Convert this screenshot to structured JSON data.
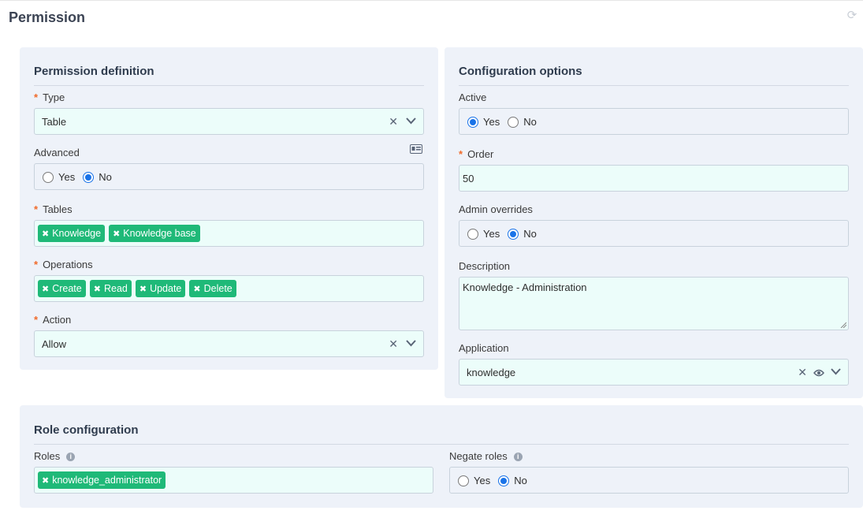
{
  "page": {
    "title": "Permission",
    "refresh_icon": "refresh-icon"
  },
  "permission_definition": {
    "title": "Permission definition",
    "type": {
      "label": "Type",
      "value": "Table"
    },
    "advanced": {
      "label": "Advanced",
      "yes": "Yes",
      "no": "No",
      "selected": "No"
    },
    "tables": {
      "label": "Tables",
      "tags": [
        "Knowledge",
        "Knowledge base"
      ]
    },
    "operations": {
      "label": "Operations",
      "tags": [
        "Create",
        "Read",
        "Update",
        "Delete"
      ]
    },
    "action": {
      "label": "Action",
      "value": "Allow"
    }
  },
  "configuration": {
    "title": "Configuration options",
    "active": {
      "label": "Active",
      "yes": "Yes",
      "no": "No",
      "selected": "Yes"
    },
    "order": {
      "label": "Order",
      "value": "50"
    },
    "admin_overrides": {
      "label": "Admin overrides",
      "yes": "Yes",
      "no": "No",
      "selected": "No"
    },
    "description": {
      "label": "Description",
      "value": "Knowledge - Administration"
    },
    "application": {
      "label": "Application",
      "value": "knowledge"
    }
  },
  "role_configuration": {
    "title": "Role configuration",
    "roles": {
      "label": "Roles",
      "tags": [
        "knowledge_administrator"
      ]
    },
    "negate_roles": {
      "label": "Negate roles",
      "yes": "Yes",
      "no": "No",
      "selected": "No"
    }
  },
  "colors": {
    "tag": "#1fb978",
    "panel": "#eef2f9",
    "field": "#ecfdfa",
    "required": "#f06a2a",
    "radio": "#1a73e8"
  }
}
